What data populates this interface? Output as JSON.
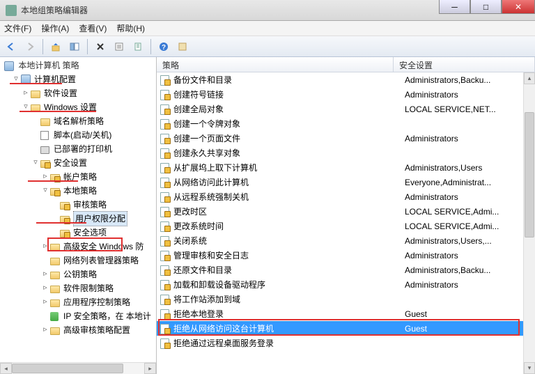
{
  "window": {
    "title": "本地组策略编辑器"
  },
  "menu": {
    "file": "文件(F)",
    "action": "操作(A)",
    "view": "查看(V)",
    "help": "帮助(H)"
  },
  "tree": {
    "root": "本地计算机 策略",
    "computer_config": "计算机配置",
    "software_settings": "软件设置",
    "windows_settings": "Windows 设置",
    "dns_policy": "域名解析策略",
    "scripts": "脚本(启动/关机)",
    "printers": "已部署的打印机",
    "security_settings": "安全设置",
    "account_policy": "帐户策略",
    "local_policy": "本地策略",
    "audit_policy": "审核策略",
    "user_rights": "用户权限分配",
    "security_options": "安全选项",
    "adv_firewall": "高级安全 Windows 防",
    "netlist_mgr": "网络列表管理器策略",
    "pubkey_policy": "公钥策略",
    "software_restrict": "软件限制策略",
    "app_control": "应用程序控制策略",
    "ipsec": "IP 安全策略，在 本地计",
    "adv_audit": "高级审核策略配置"
  },
  "list": {
    "headers": {
      "policy": "策略",
      "setting": "安全设置"
    },
    "rows": [
      {
        "policy": "备份文件和目录",
        "setting": "Administrators,Backu..."
      },
      {
        "policy": "创建符号链接",
        "setting": "Administrators"
      },
      {
        "policy": "创建全局对象",
        "setting": "LOCAL SERVICE,NET..."
      },
      {
        "policy": "创建一个令牌对象",
        "setting": ""
      },
      {
        "policy": "创建一个页面文件",
        "setting": "Administrators"
      },
      {
        "policy": "创建永久共享对象",
        "setting": ""
      },
      {
        "policy": "从扩展坞上取下计算机",
        "setting": "Administrators,Users"
      },
      {
        "policy": "从网络访问此计算机",
        "setting": "Everyone,Administrat..."
      },
      {
        "policy": "从远程系统强制关机",
        "setting": "Administrators"
      },
      {
        "policy": "更改时区",
        "setting": "LOCAL SERVICE,Admi..."
      },
      {
        "policy": "更改系统时间",
        "setting": "LOCAL SERVICE,Admi..."
      },
      {
        "policy": "关闭系统",
        "setting": "Administrators,Users,..."
      },
      {
        "policy": "管理审核和安全日志",
        "setting": "Administrators"
      },
      {
        "policy": "还原文件和目录",
        "setting": "Administrators,Backu..."
      },
      {
        "policy": "加载和卸载设备驱动程序",
        "setting": "Administrators"
      },
      {
        "policy": "将工作站添加到域",
        "setting": ""
      },
      {
        "policy": "拒绝本地登录",
        "setting": "Guest"
      },
      {
        "policy": "拒绝从网络访问这台计算机",
        "setting": "Guest",
        "selected": true
      },
      {
        "policy": "拒绝通过远程桌面服务登录",
        "setting": ""
      }
    ]
  }
}
